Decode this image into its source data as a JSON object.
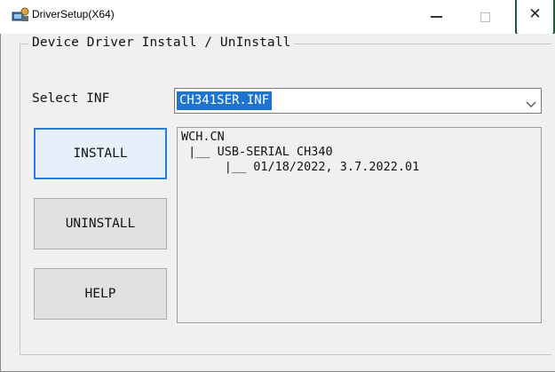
{
  "window": {
    "title": "DriverSetup(X64)",
    "icons": {
      "app": "driver-setup-app-icon",
      "minimize": "minimize-icon",
      "maximize": "maximize-icon",
      "close": "close-icon"
    },
    "close_glyph": "✕",
    "highlight_color": "#1f5a36"
  },
  "group": {
    "legend": "Device Driver Install / UnInstall"
  },
  "select_inf": {
    "label": "Select INF",
    "value": "CH341SER.INF",
    "selection_color": "#1d73d0"
  },
  "buttons": {
    "install": "INSTALL",
    "uninstall": "UNINSTALL",
    "help": "HELP"
  },
  "info": {
    "lines": [
      "WCH.CN",
      " |__ USB-SERIAL CH340",
      "      |__ 01/18/2022, 3.7.2022.01"
    ]
  }
}
